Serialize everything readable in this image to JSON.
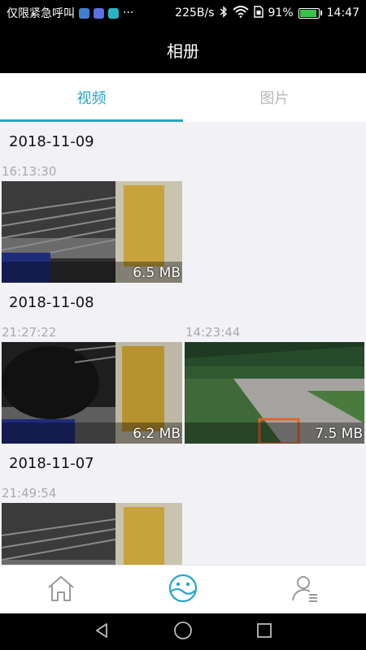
{
  "status_bar": {
    "carrier": "仅限紧急呼叫",
    "more": "···",
    "speed": "225B/s",
    "battery": "91%",
    "time": "14:47"
  },
  "title": "相册",
  "tabs": [
    {
      "label": "视频",
      "active": true
    },
    {
      "label": "图片",
      "active": false
    }
  ],
  "groups": [
    {
      "date": "2018-11-09",
      "items": [
        {
          "time": "16:13:30",
          "size": "6.5 MB",
          "scene": "indoor-chair"
        }
      ]
    },
    {
      "date": "2018-11-08",
      "items": [
        {
          "time": "21:27:22",
          "size": "6.2 MB",
          "scene": "indoor-chair-dark"
        },
        {
          "time": "14:23:44",
          "size": "7.5 MB",
          "scene": "outdoor-path"
        }
      ]
    },
    {
      "date": "2018-11-07",
      "items": [
        {
          "time": "21:49:54",
          "size": "",
          "scene": "indoor-chair"
        }
      ]
    }
  ],
  "bottom_nav": [
    {
      "icon": "home-icon",
      "active": false
    },
    {
      "icon": "album-icon",
      "active": true
    },
    {
      "icon": "user-menu-icon",
      "active": false
    }
  ],
  "colors": {
    "accent": "#2aa5c8",
    "inactive": "#b9b9b9",
    "background": "#f2f1f6"
  }
}
